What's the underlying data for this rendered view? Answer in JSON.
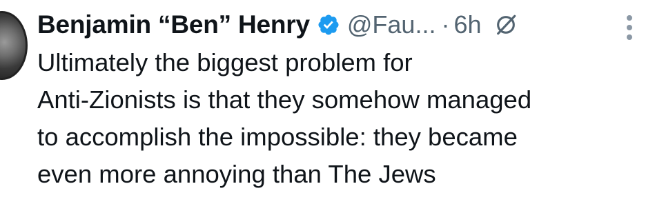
{
  "tweet": {
    "display_name": "Benjamin “Ben” Henry",
    "handle": "@Fau...",
    "separator": "·",
    "time": "6h",
    "text": "Ultimately the biggest problem for\nAnti-Zionists is that they somehow managed\nto accomplish the impossible: they became\neven more annoying than The Jews"
  },
  "icons": {
    "verified": "verified-badge-icon",
    "grok": "grok-icon",
    "more": "more-options-icon"
  },
  "colors": {
    "text": "#0f1419",
    "secondary": "#536471",
    "verified": "#1d9bf0"
  }
}
